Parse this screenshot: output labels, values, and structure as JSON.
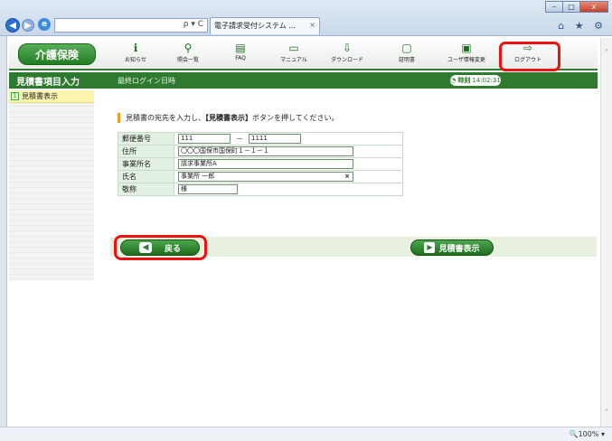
{
  "browser": {
    "tab_title": "電子請求受付システム ...",
    "tab_close": "×",
    "address_tools": "ρ ▾ C",
    "toolbar_glyphs": "⌂ ★ ⚙",
    "window_controls": [
      "‒",
      "□",
      "x"
    ],
    "zoom": "🔍100%  ▾"
  },
  "header": {
    "service_label": "介護保険",
    "menu": [
      {
        "label": "お知らせ",
        "icon": "notice-icon",
        "glyph": "ℹ"
      },
      {
        "label": "照会一覧",
        "icon": "search-icon",
        "glyph": "⚲"
      },
      {
        "label": "FAQ",
        "icon": "faq-icon",
        "glyph": "▤"
      },
      {
        "label": "マニュアル",
        "icon": "manual-icon",
        "glyph": "▭"
      },
      {
        "label": "ダウンロード",
        "icon": "download-icon",
        "glyph": "⇩"
      },
      {
        "label": "証明書",
        "icon": "certificate-icon",
        "glyph": "▢"
      },
      {
        "label": "ユーザ情報変更",
        "icon": "user-info-icon",
        "glyph": "▣"
      },
      {
        "label": "ログアウト",
        "icon": "logout-icon",
        "glyph": "⇨"
      }
    ]
  },
  "subbar": {
    "page_title": "見積書項目入力",
    "last_login_label": "最終ログイン日時",
    "time_label": "時刻",
    "time_value": "14:02:31"
  },
  "sidebar": {
    "items": [
      {
        "num": "1",
        "label": "見積書表示"
      }
    ]
  },
  "main": {
    "instruction_before": "見積書の宛先を入力し、",
    "instruction_bold": "【見積書表示】",
    "instruction_after": "ボタンを押してください。",
    "fields": {
      "postal_label": "郵便番号",
      "postal_1": "111",
      "postal_sep": "－",
      "postal_2": "1111",
      "address_label": "住所",
      "address_value": "〇〇〇国保市国保町１－１－１",
      "office_label": "事業所名",
      "office_value": "請求事業所A",
      "name_label": "氏名",
      "name_value": "事業所 一郎",
      "name_clear": "×",
      "honorific_label": "敬称",
      "honorific_value": "様"
    },
    "back_button": "戻る",
    "show_button": "見積書表示"
  }
}
